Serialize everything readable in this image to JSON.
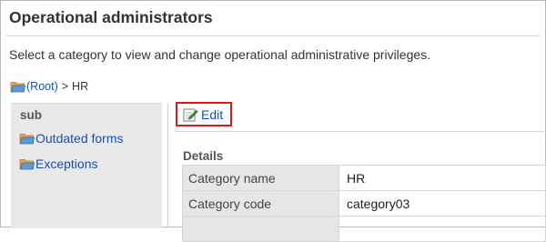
{
  "page": {
    "title": "Operational administrators",
    "description": "Select a category to view and change operational administrative privileges."
  },
  "breadcrumb": {
    "root_label": "(Root)",
    "separator": ">",
    "current": "HR"
  },
  "sidebar": {
    "heading": "sub",
    "items": [
      {
        "label": "Outdated forms",
        "icon": "folder-icon"
      },
      {
        "label": "Exceptions",
        "icon": "folder-icon"
      }
    ]
  },
  "toolbar": {
    "edit_label": "Edit",
    "edit_icon": "pencil-icon",
    "highlight_color": "#e0141b"
  },
  "details": {
    "heading": "Details",
    "rows": [
      {
        "label": "Category name",
        "value": "HR"
      },
      {
        "label": "Category code",
        "value": "category03"
      },
      {
        "label": "",
        "value": ""
      }
    ]
  },
  "colors": {
    "link": "#1a4fb0",
    "folder_tab": "#e8a64a",
    "folder_front": "#5b9bd5",
    "sidebar_bg": "#e9e9e9",
    "table_header_bg": "#e6e6e6"
  }
}
